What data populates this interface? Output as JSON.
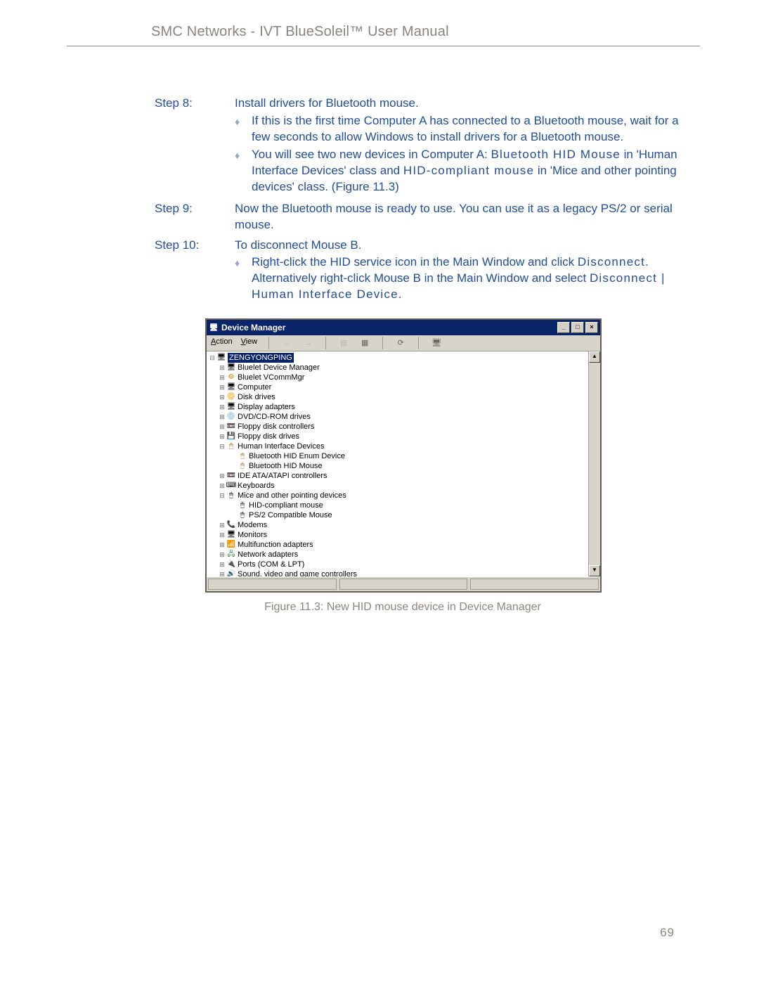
{
  "header": {
    "title": "SMC Networks - IVT BlueSoleil™ User Manual"
  },
  "steps": {
    "s8": {
      "label": "Step 8:",
      "title": "Install drivers for Bluetooth mouse.",
      "b1": "If this is the first time Computer A has connected to a Bluetooth mouse, wait for a few seconds to allow Windows to install drivers for a Bluetooth mouse.",
      "b2a": "You will see two new devices in Computer A: ",
      "b2b": "Bluetooth HID Mouse",
      "b2c": " in 'Human Interface Devices' class and ",
      "b2d": "HID-compliant mouse",
      "b2e": " in 'Mice and other pointing devices' class. (Figure 11.3)"
    },
    "s9": {
      "label": "Step 9:",
      "body": "Now the Bluetooth mouse is ready to use. You can use it as a legacy PS/2 or serial mouse."
    },
    "s10": {
      "label": "Step 10:",
      "title": "To disconnect Mouse B.",
      "b1a": "Right-click the HID service icon in the Main Window and click ",
      "b1b": "Disconnect",
      "b1c": ". Alternatively right-click Mouse B in the Main Window and select ",
      "b1d": "Disconnect | Human Interface Device",
      "b1e": "."
    }
  },
  "dm": {
    "title": "Device Manager",
    "menu": {
      "action": "Action",
      "view": "View"
    },
    "root": "ZENGYONGPING",
    "nodes": {
      "n1": "Bluelet Device Manager",
      "n2": "Bluelet VCommMgr",
      "n3": "Computer",
      "n4": "Disk drives",
      "n5": "Display adapters",
      "n6": "DVD/CD-ROM drives",
      "n7": "Floppy disk controllers",
      "n8": "Floppy disk drives",
      "n9": "Human Interface Devices",
      "n9a": "Bluetooth HID Enum Device",
      "n9b": "Bluetooth HID Mouse",
      "n10": "IDE ATA/ATAPI controllers",
      "n11": "Keyboards",
      "n12": "Mice and other pointing devices",
      "n12a": "HID-compliant mouse",
      "n12b": "PS/2 Compatible Mouse",
      "n13": "Modems",
      "n14": "Monitors",
      "n15": "Multifunction adapters",
      "n16": "Network adapters",
      "n17": "Ports (COM & LPT)",
      "n18": "Sound, video and game controllers"
    }
  },
  "caption": "Figure 11.3: New HID mouse device in Device Manager",
  "page_number": "69"
}
